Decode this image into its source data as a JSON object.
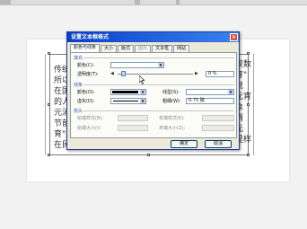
{
  "document": {
    "textbox_left_lines": [
      "传统",
      "所以",
      "在国",
      "的人",
      "元消",
      "节前",
      "育\"兴",
      "在民"
    ],
    "textbox_right_lines": [
      "双数",
      "育\"",
      "说",
      "元宵",
      "象",
      "消",
      "元",
      "提样"
    ]
  },
  "dialog": {
    "title": "设置文本框格式",
    "close_label": "×",
    "tabs": [
      "颜色与线条",
      "大小",
      "版式",
      "图片",
      "文本框",
      "网站"
    ],
    "fill": {
      "group_label": "填充",
      "color_label": "颜色(C):",
      "transparency_label": "透明度(T):",
      "transparency_value": "0 %"
    },
    "line": {
      "group_label": "线条",
      "color_label": "颜色(O):",
      "dashed_label": "虚实(D):",
      "style_label": "线型(S):",
      "weight_label": "粗细(W):",
      "weight_value": "0.75 磅"
    },
    "arrows": {
      "group_label": "箭头",
      "begin_style_label": "始端样式(B):",
      "begin_size_label": "始端大小(I):",
      "end_style_label": "末端样式(E):",
      "end_size_label": "末端大小(Z):"
    },
    "ok_label": "确定",
    "cancel_label": "取消"
  },
  "colors": {
    "line_color": "#000000",
    "titlebar": "#0a3fc8"
  }
}
